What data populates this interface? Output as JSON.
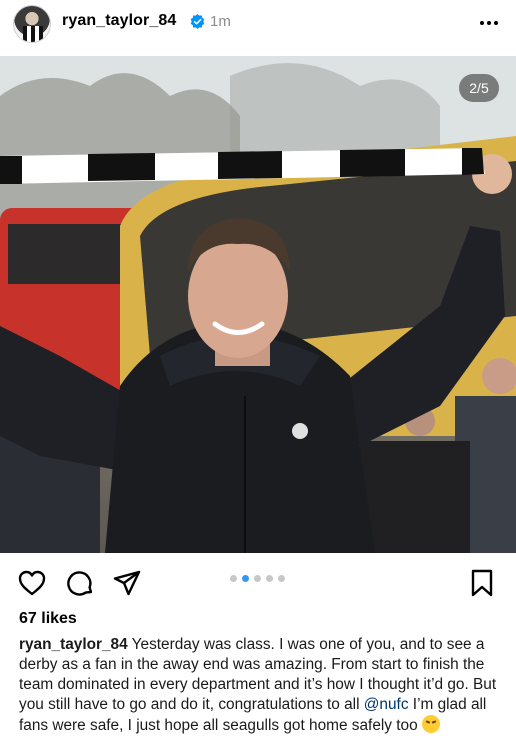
{
  "post": {
    "username": "ryan_taylor_84",
    "time": "1m",
    "carousel_counter": "2/5",
    "likes": "67 likes"
  },
  "caption": {
    "username": "ryan_taylor_84",
    "text_part1": " Yesterday was class. I was one of you, and to see a derby as a fan in the away end was amazing. From start to finish the team dominated in every department and it’s how I thought it’d go. But you still have to go and do it, congratulations to all ",
    "mention": "@nufc",
    "text_part2": " I’m glad all fans were safe, I just hope all seagulls got home safely too ",
    "emoji": "rolling-on-floor-laughing-emoji"
  },
  "carousel": {
    "total": 5,
    "active_index": 1
  },
  "colors": {
    "accent_blue": "#3797f0",
    "verified_blue": "#0095f6",
    "secondary_text": "#8e8e8e",
    "mention": "#00376b"
  },
  "icons": [
    "heart-icon",
    "comment-icon",
    "share-icon",
    "save-icon",
    "more-icon",
    "verified-icon"
  ]
}
